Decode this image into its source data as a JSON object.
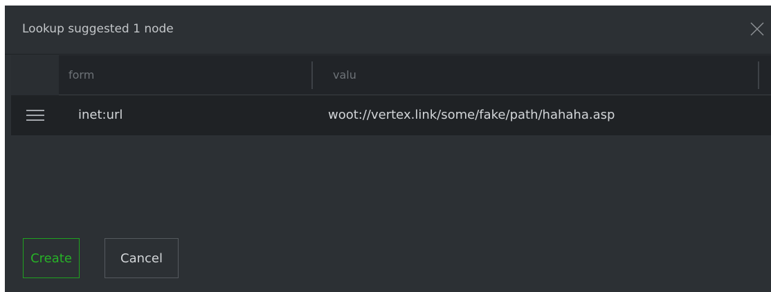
{
  "dialog": {
    "title": "Lookup suggested 1 node",
    "close_icon": "close-icon"
  },
  "table": {
    "columns": [
      "form",
      "valu"
    ],
    "rows": [
      {
        "handle_icon": "drag-handle-icon",
        "form": "inet:url",
        "valu": "woot://vertex.link/some/fake/path/hahaha.asp"
      }
    ]
  },
  "actions": {
    "create_label": "Create",
    "cancel_label": "Cancel"
  },
  "colors": {
    "dialog_bg": "#2c3034",
    "table_header_bg": "#212428",
    "row_bg": "#1f2225",
    "primary_accent": "#27b327"
  }
}
